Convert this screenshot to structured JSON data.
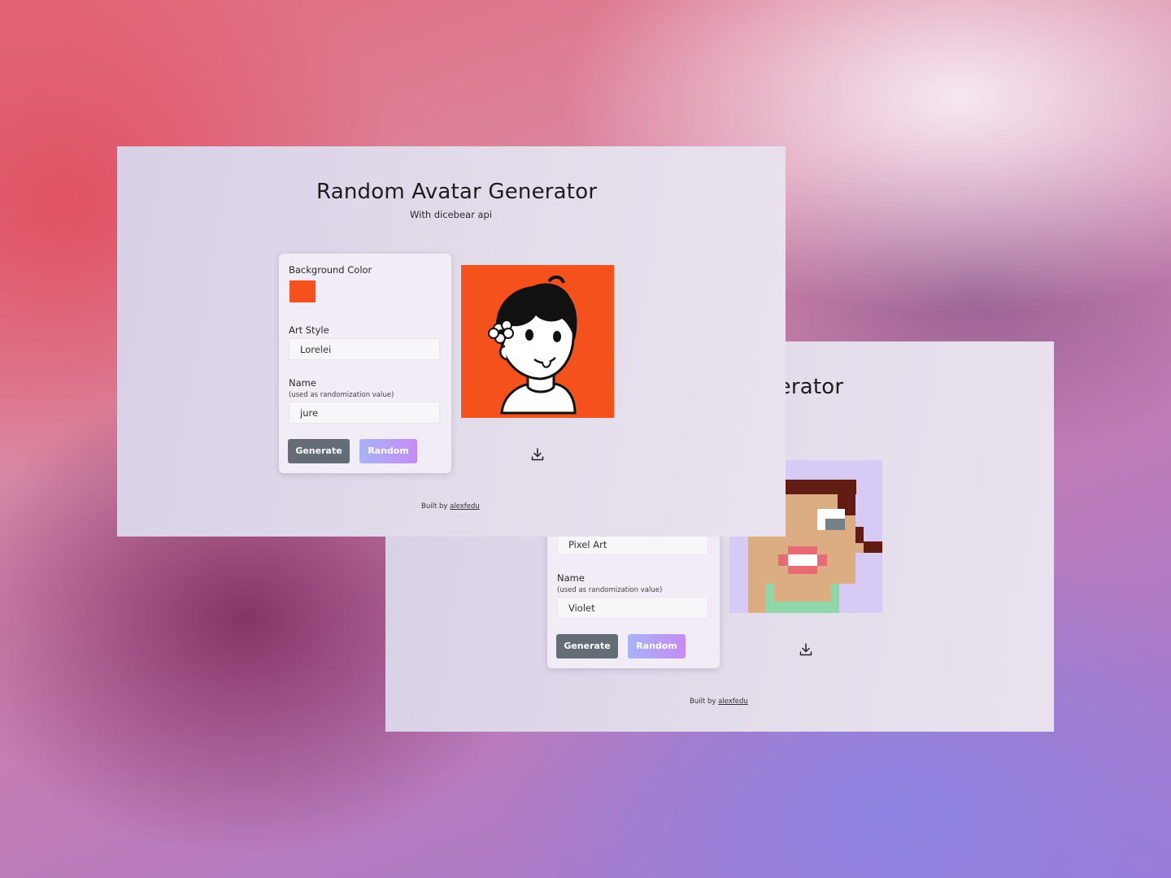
{
  "screens": {
    "front": {
      "title": "Random Avatar Generator",
      "subtitle": "With dicebear api",
      "background_color_label": "Background Color",
      "background_color_value": "#f5511d",
      "art_style_label": "Art Style",
      "art_style_value": "Lorelei",
      "name_label": "Name",
      "name_hint": "(used as randomization value)",
      "name_value": "jure",
      "generate_label": "Generate",
      "random_label": "Random",
      "footer_text": "Built by",
      "footer_link": "alexfedu",
      "avatar_icon": "lorelei-avatar",
      "download_icon": "download-icon"
    },
    "back": {
      "title_fragment": "nerator",
      "art_style_value": "Pixel Art",
      "name_label": "Name",
      "name_hint": "(used as randomization value)",
      "name_value": "Violet",
      "generate_label": "Generate",
      "random_label": "Random",
      "footer_text": "Built by",
      "footer_link": "alexfedu",
      "avatar_icon": "pixel-art-avatar",
      "download_icon": "download-icon"
    }
  },
  "colors": {
    "generate_button": "#646c76",
    "random_button_gradient": [
      "#a7b3f7",
      "#c68cf2"
    ],
    "pixel_avatar_background": "#d7cbf6"
  }
}
